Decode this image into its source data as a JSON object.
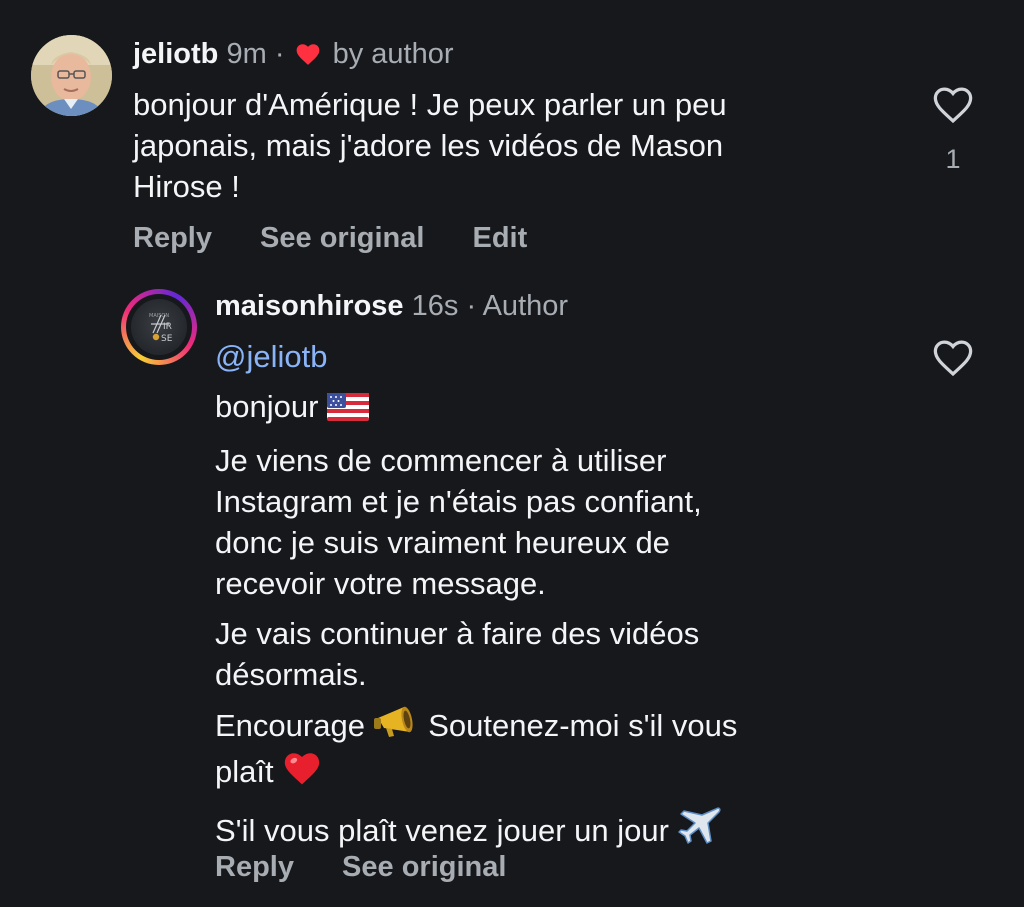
{
  "comments": [
    {
      "username": "jeliotb",
      "time": "9m",
      "separator": "·",
      "badge": "by author",
      "text_lines": [
        "bonjour d'Amérique ! Je peux parler un peu",
        "japonais, mais j'adore les vidéos de Mason",
        "Hirose !"
      ],
      "like_count": "1",
      "actions": {
        "reply": "Reply",
        "see_original": "See original",
        "edit": "Edit"
      }
    },
    {
      "username": "maisonhirose",
      "time": "16s",
      "separator": "·",
      "badge": "Author",
      "mention": "@jeliotb",
      "paragraphs": [
        "bonjour",
        "Je viens de commencer à utiliser\nInstagram et je n'étais pas confiant,\ndonc je suis vraiment heureux de\nrecevoir votre message.",
        "Je vais continuer à faire des vidéos\ndésormais.",
        "Encourage",
        "Soutenez-moi s'il vous",
        "plaît",
        "S'il vous plaît venez jouer un jour"
      ],
      "actions": {
        "reply": "Reply",
        "see_original": "See original"
      }
    }
  ],
  "colors": {
    "background": "#16181c",
    "text": "#f3f5f7",
    "secondary": "#a8adb3",
    "mention": "#8ab4f8",
    "heart": "#ff3040"
  },
  "icons": [
    "heart-icon",
    "like-outline-icon",
    "us-flag-emoji",
    "megaphone-emoji",
    "red-heart-emoji",
    "airplane-emoji"
  ]
}
